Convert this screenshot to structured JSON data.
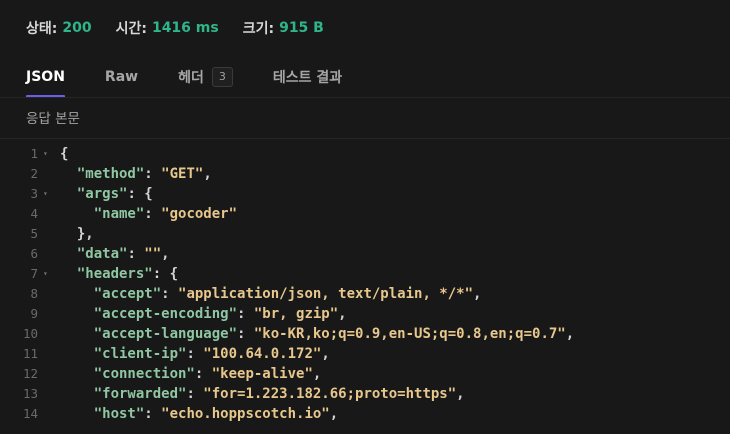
{
  "status": {
    "status_label": "상태:",
    "status_value": "200",
    "time_label": "시간:",
    "time_value": "1416 ms",
    "size_label": "크기:",
    "size_value": "915 B"
  },
  "tabs": [
    {
      "label": "JSON",
      "active": true
    },
    {
      "label": "Raw",
      "active": false
    },
    {
      "label": "헤더",
      "badge": "3",
      "active": false
    },
    {
      "label": "테스트 결과",
      "active": false
    }
  ],
  "section_title": "응답 본문",
  "code_lines": [
    {
      "n": "1",
      "fold": true,
      "indent": "",
      "segs": [
        [
          "p",
          "{"
        ]
      ]
    },
    {
      "n": "2",
      "fold": false,
      "indent": "  ",
      "segs": [
        [
          "k",
          "\"method\""
        ],
        [
          "p",
          ": "
        ],
        [
          "s",
          "\"GET\""
        ],
        [
          "p",
          ","
        ]
      ]
    },
    {
      "n": "3",
      "fold": true,
      "indent": "  ",
      "segs": [
        [
          "k",
          "\"args\""
        ],
        [
          "p",
          ": {"
        ]
      ]
    },
    {
      "n": "4",
      "fold": false,
      "indent": "    ",
      "segs": [
        [
          "k",
          "\"name\""
        ],
        [
          "p",
          ": "
        ],
        [
          "s",
          "\"gocoder\""
        ]
      ]
    },
    {
      "n": "5",
      "fold": false,
      "indent": "  ",
      "segs": [
        [
          "p",
          "},"
        ]
      ]
    },
    {
      "n": "6",
      "fold": false,
      "indent": "  ",
      "segs": [
        [
          "k",
          "\"data\""
        ],
        [
          "p",
          ": "
        ],
        [
          "s",
          "\"\""
        ],
        [
          "p",
          ","
        ]
      ]
    },
    {
      "n": "7",
      "fold": true,
      "indent": "  ",
      "segs": [
        [
          "k",
          "\"headers\""
        ],
        [
          "p",
          ": {"
        ]
      ]
    },
    {
      "n": "8",
      "fold": false,
      "indent": "    ",
      "segs": [
        [
          "k",
          "\"accept\""
        ],
        [
          "p",
          ": "
        ],
        [
          "s",
          "\"application/json, text/plain, */*\""
        ],
        [
          "p",
          ","
        ]
      ]
    },
    {
      "n": "9",
      "fold": false,
      "indent": "    ",
      "segs": [
        [
          "k",
          "\"accept-encoding\""
        ],
        [
          "p",
          ": "
        ],
        [
          "s",
          "\"br, gzip\""
        ],
        [
          "p",
          ","
        ]
      ]
    },
    {
      "n": "10",
      "fold": false,
      "indent": "    ",
      "segs": [
        [
          "k",
          "\"accept-language\""
        ],
        [
          "p",
          ": "
        ],
        [
          "s",
          "\"ko-KR,ko;q=0.9,en-US;q=0.8,en;q=0.7\""
        ],
        [
          "p",
          ","
        ]
      ]
    },
    {
      "n": "11",
      "fold": false,
      "indent": "    ",
      "segs": [
        [
          "k",
          "\"client-ip\""
        ],
        [
          "p",
          ": "
        ],
        [
          "s",
          "\"100.64.0.172\""
        ],
        [
          "p",
          ","
        ]
      ]
    },
    {
      "n": "12",
      "fold": false,
      "indent": "    ",
      "segs": [
        [
          "k",
          "\"connection\""
        ],
        [
          "p",
          ": "
        ],
        [
          "s",
          "\"keep-alive\""
        ],
        [
          "p",
          ","
        ]
      ]
    },
    {
      "n": "13",
      "fold": false,
      "indent": "    ",
      "segs": [
        [
          "k",
          "\"forwarded\""
        ],
        [
          "p",
          ": "
        ],
        [
          "s",
          "\"for=1.223.182.66;proto=https\""
        ],
        [
          "p",
          ","
        ]
      ]
    },
    {
      "n": "14",
      "fold": false,
      "indent": "    ",
      "segs": [
        [
          "k",
          "\"host\""
        ],
        [
          "p",
          ": "
        ],
        [
          "s",
          "\"echo.hoppscotch.io\""
        ],
        [
          "p",
          ","
        ]
      ]
    }
  ],
  "colors": {
    "accent": "#6b5fe6",
    "status_value": "#2fb58a",
    "json_key": "#8fc7a3",
    "json_string": "#e8c78d"
  }
}
